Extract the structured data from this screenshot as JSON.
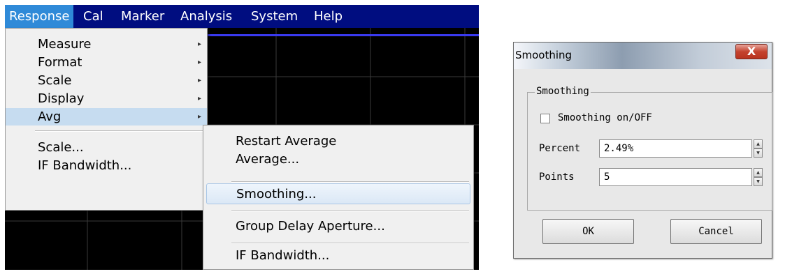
{
  "menubar": {
    "items": [
      "Response",
      "Cal",
      "Marker",
      "Analysis",
      "System",
      "Help"
    ],
    "active": "Response"
  },
  "response_menu": {
    "items": [
      {
        "label": "Measure",
        "submenu": true
      },
      {
        "label": "Format",
        "submenu": true
      },
      {
        "label": "Scale",
        "submenu": true
      },
      {
        "label": "Display",
        "submenu": true
      },
      {
        "label": "Avg",
        "submenu": true,
        "highlighted": true
      },
      {
        "label": "Scale...",
        "submenu": false
      },
      {
        "label": "IF Bandwidth...",
        "submenu": false
      }
    ],
    "arrow_glyph": "▸"
  },
  "avg_submenu": {
    "items": [
      {
        "label": "Restart Average"
      },
      {
        "label": "Average..."
      },
      {
        "label": "Smoothing...",
        "highlighted": true
      },
      {
        "label": "Group Delay Aperture..."
      },
      {
        "label": "IF Bandwidth..."
      }
    ]
  },
  "dialog": {
    "title": "Smoothing",
    "close_glyph": "X",
    "group_label": "Smoothing",
    "checkbox_label": "Smoothing on/OFF",
    "checkbox_checked": false,
    "percent_label": "Percent",
    "percent_value": "2.49%",
    "points_label": "Points",
    "points_value": "5",
    "spin_up": "▲",
    "spin_down": "▼",
    "ok_label": "OK",
    "cancel_label": "Cancel"
  },
  "colors": {
    "menubar_bg": "#000d80",
    "menubar_active": "#2f8ad8",
    "menu_bg": "#f0f0f0",
    "menu_highlight": "#c6dcf0",
    "graticule": "#3a3a3a",
    "close_button": "#c4432f"
  }
}
